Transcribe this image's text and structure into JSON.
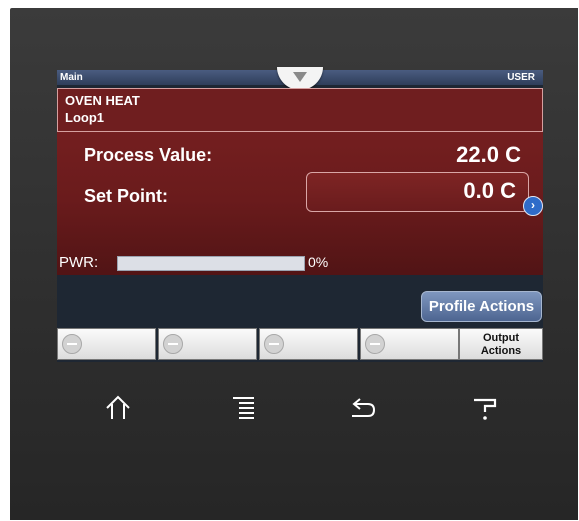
{
  "topbar": {
    "left": "Main",
    "right": "USER"
  },
  "loop": {
    "name": "OVEN HEAT",
    "id": "Loop1",
    "process_value_label": "Process Value:",
    "process_value": "22.0 C",
    "set_point_label": "Set Point:",
    "set_point": "0.0 C",
    "pwr_label": "PWR:",
    "pwr_percent_text": "0%",
    "pwr_fraction": 0.0
  },
  "profile_actions_label": "Profile Actions",
  "softkeys": [
    "",
    "",
    "",
    ""
  ],
  "output_actions": {
    "line1": "Output",
    "line2": "Actions"
  },
  "nav": [
    "home-icon",
    "menu-icon",
    "back-icon",
    "help-icon"
  ],
  "colors": {
    "loop_panel": "#6a1b1c",
    "screen_bg": "#1e2733",
    "profile_button": "#5b74a0",
    "set_point_arrow": "#2f6cc9"
  }
}
